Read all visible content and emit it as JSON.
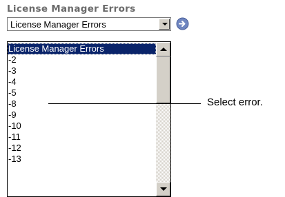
{
  "title": "License Manager Errors",
  "combo": {
    "value": "License Manager Errors",
    "dropdown_icon": "chevron-down-icon"
  },
  "go_icon": "arrow-right-circle-icon",
  "list": {
    "items": [
      {
        "label": "License Manager Errors",
        "selected": true
      },
      {
        "label": "-2"
      },
      {
        "label": "-3"
      },
      {
        "label": "-4"
      },
      {
        "label": "-5"
      },
      {
        "label": "-8"
      },
      {
        "label": "-9"
      },
      {
        "label": "-10"
      },
      {
        "label": "-11"
      },
      {
        "label": "-12"
      },
      {
        "label": "-13"
      }
    ]
  },
  "callout": {
    "text": "Select error."
  },
  "colors": {
    "title": "#6b6b6b",
    "selection": "#0a246a",
    "go_icon": "#6f86c0"
  }
}
